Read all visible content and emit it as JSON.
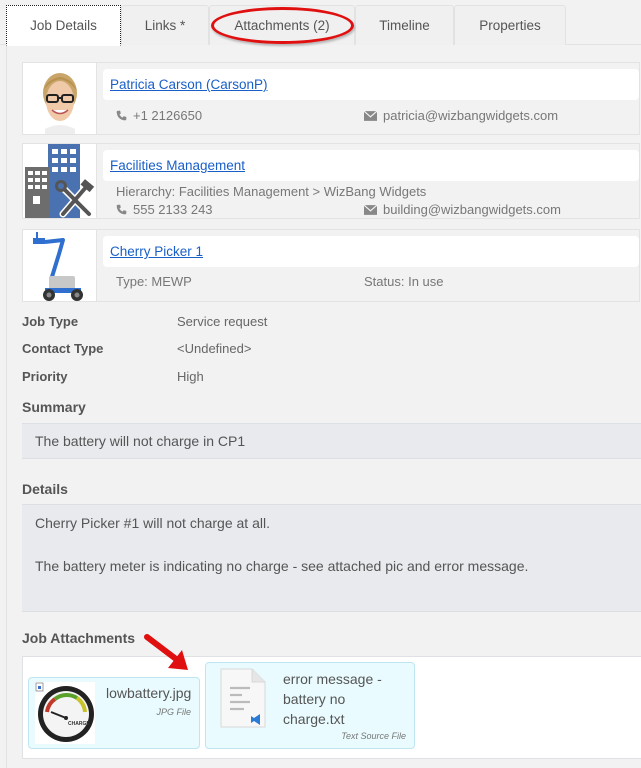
{
  "tabs": [
    {
      "label": "Job Details",
      "active": true
    },
    {
      "label": "Links *",
      "active": false
    },
    {
      "label": "Attachments (2)",
      "active": false,
      "highlighted": true
    },
    {
      "label": "Timeline",
      "active": false
    },
    {
      "label": "Properties",
      "active": false
    }
  ],
  "contact": {
    "name": "Patricia Carson (CarsonP)",
    "phone": "+1 2126650",
    "email": "patricia@wizbangwidgets.com",
    "avatar_icon": "person-photo"
  },
  "department": {
    "name": "Facilities Management",
    "hierarchy": "Hierarchy: Facilities Management > WizBang Widgets",
    "phone": "555 2133 243",
    "email": "building@wizbangwidgets.com",
    "icon": "building-tools-icon"
  },
  "asset": {
    "name": "Cherry Picker 1",
    "type": "Type: MEWP",
    "status": "Status: In use",
    "icon": "cherry-picker-photo"
  },
  "fields": [
    {
      "label": "Job Type",
      "value": "Service request"
    },
    {
      "label": "Contact Type",
      "value": "<Undefined>"
    },
    {
      "label": "Priority",
      "value": "High"
    }
  ],
  "summary": {
    "heading": "Summary",
    "text": "The battery will not charge in CP1"
  },
  "details": {
    "heading": "Details",
    "line1": "Cherry Picker #1 will not charge at all.",
    "line2": "The battery meter is indicating no charge - see attached pic and error message."
  },
  "attachments": {
    "heading": "Job Attachments",
    "items": [
      {
        "name": "lowbattery.jpg",
        "type": "JPG File",
        "icon": "battery-gauge-thumbnail"
      },
      {
        "name_lines": [
          "error message -",
          "battery no",
          "charge.txt"
        ],
        "type": "Text Source File",
        "icon": "text-file-icon"
      }
    ]
  },
  "colors": {
    "link": "#1a5fc8",
    "highlight": "#e01010",
    "attachment_bg": "#e9fbfe",
    "textbox_bg": "#e8eaed"
  }
}
